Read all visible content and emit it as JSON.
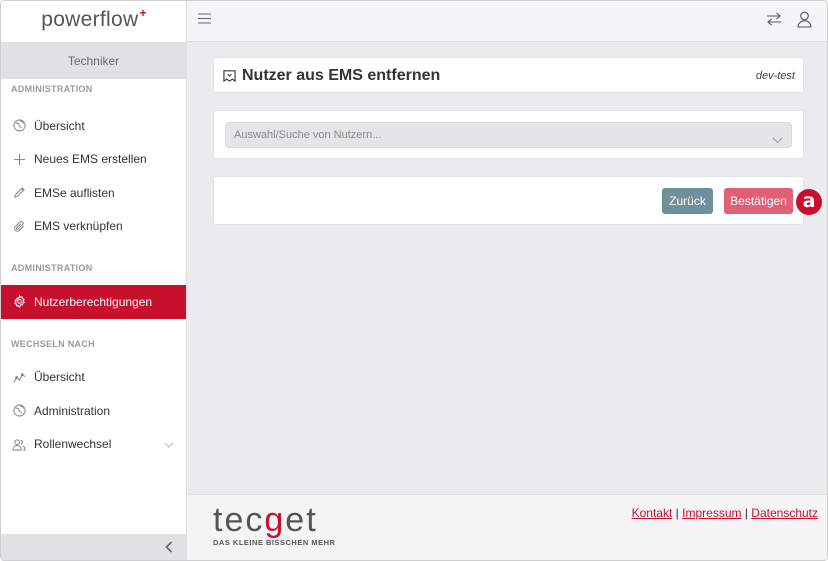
{
  "sidebar": {
    "logo_text": "powerflow",
    "logo_mark": "+",
    "role": "Techniker",
    "sections": [
      {
        "heading": "ADMINISTRATION",
        "items": [
          {
            "label": "Übersicht",
            "icon": "globe-icon"
          },
          {
            "label": "Neues EMS erstellen",
            "icon": "plus-icon"
          },
          {
            "label": "EMSe auflisten",
            "icon": "pencil-icon"
          },
          {
            "label": "EMS verknüpfen",
            "icon": "paperclip-icon"
          }
        ]
      },
      {
        "heading": "ADMINISTRATION",
        "items": [
          {
            "label": "Nutzerberechtigungen",
            "icon": "gear-icon",
            "active": true
          }
        ]
      },
      {
        "heading": "WECHSELN NACH",
        "items": [
          {
            "label": "Übersicht",
            "icon": "chart-line-icon"
          },
          {
            "label": "Administration",
            "icon": "globe-icon"
          },
          {
            "label": "Rollenwechsel",
            "icon": "users-icon"
          }
        ]
      }
    ]
  },
  "main": {
    "title": "Nutzer aus EMS entfernen",
    "environment": "dev-test",
    "user_select_placeholder": "Auswahl/Suche von Nutzern...",
    "back_label": "Zurück",
    "confirm_label": "Bestätigen",
    "annotation_badge": "a"
  },
  "footer": {
    "brand_pre": "tec",
    "brand_mid": "g",
    "brand_post": "et",
    "tagline": "DAS KLEINE BISSCHEN MEHR",
    "links": [
      "Kontakt",
      "Impressum",
      "Datenschutz"
    ],
    "separator": "|"
  },
  "colors": {
    "accent": "#c8102e",
    "confirm_button": "#e06075",
    "back_button": "#6f8f9a"
  }
}
